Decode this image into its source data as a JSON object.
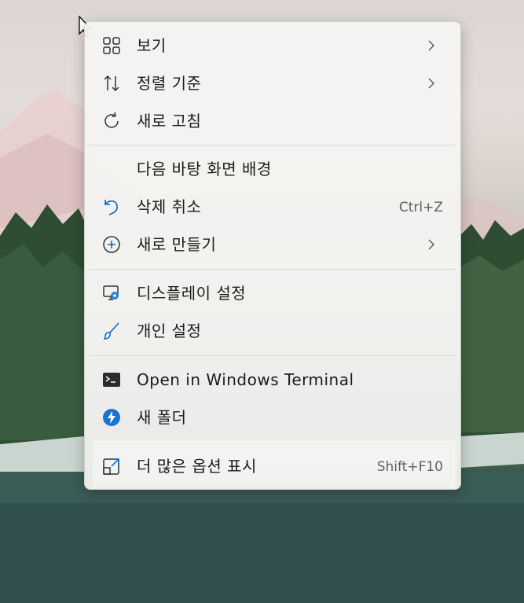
{
  "menu": {
    "items": [
      {
        "label": "보기",
        "icon": "grid-view-icon",
        "submenu": true
      },
      {
        "label": "정렬 기준",
        "icon": "sort-arrows-icon",
        "submenu": true
      },
      {
        "label": "새로 고침",
        "icon": "refresh-icon"
      },
      {
        "label": "다음 바탕 화면 배경",
        "icon": "none"
      },
      {
        "label": "삭제 취소",
        "icon": "undo-icon",
        "shortcut": "Ctrl+Z"
      },
      {
        "label": "새로 만들기",
        "icon": "plus-circle-icon",
        "submenu": true
      },
      {
        "label": "디스플레이 설정",
        "icon": "display-settings-icon"
      },
      {
        "label": "개인 설정",
        "icon": "brush-icon"
      },
      {
        "label": "Open in Windows Terminal",
        "icon": "terminal-icon"
      },
      {
        "label": "새 폴더",
        "icon": "lightning-circle-icon"
      },
      {
        "label": "더 많은 옵션 표시",
        "icon": "open-external-icon",
        "shortcut": "Shift+F10"
      }
    ]
  },
  "colors": {
    "accent": "#0067c0",
    "highlight_border": "#8cbd26"
  }
}
